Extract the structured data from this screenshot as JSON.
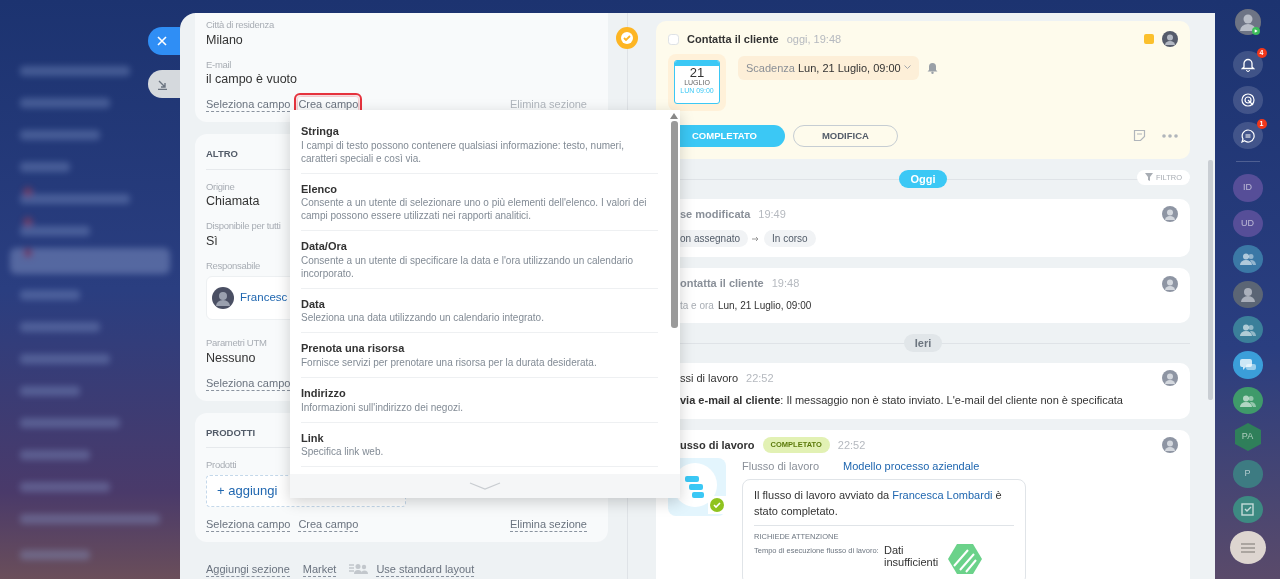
{
  "sections": [
    {
      "fields": [
        {
          "kind": "text",
          "label": "Città di residenza",
          "value": "Milano"
        },
        {
          "kind": "text",
          "label": "E-mail",
          "value": "il campo è vuoto"
        }
      ],
      "actions": [
        {
          "label": "Seleziona campo",
          "highlighted": false,
          "kind": "field"
        },
        {
          "label": "Crea campo",
          "highlighted": true,
          "kind": "field"
        },
        {
          "label": "Elimina sezione",
          "highlighted": false,
          "kind": "delete"
        }
      ]
    },
    {
      "title": "ALTRO",
      "fields": [
        {
          "kind": "text",
          "label": "Origine",
          "value": "Chiamata"
        },
        {
          "kind": "text",
          "label": "Disponibile per tutti",
          "value": "Sì"
        },
        {
          "kind": "person",
          "label": "Responsabile",
          "value": "Francesc"
        },
        {
          "kind": "text",
          "label": "Parametri UTM",
          "value": "Nessuno"
        }
      ],
      "actions": [
        {
          "label": "Seleziona campo",
          "highlighted": false,
          "kind": "field"
        }
      ]
    },
    {
      "title": "PRODOTTI",
      "fields": [
        {
          "kind": "add",
          "label": "Prodotti",
          "value": "+ aggiungi"
        }
      ],
      "actions": [
        {
          "label": "Seleziona campo",
          "highlighted": false,
          "kind": "field"
        },
        {
          "label": "Crea campo",
          "highlighted": false,
          "kind": "field"
        },
        {
          "label": "Elimina sezione",
          "highlighted": false,
          "kind": "delete"
        }
      ]
    }
  ],
  "footer_links": [
    {
      "label": "Aggiungi sezione"
    },
    {
      "label": "Market"
    }
  ],
  "layout_switch": {
    "label": "Use standard layout"
  },
  "field_type_menu": {
    "items": [
      {
        "title": "Stringa",
        "description": "I campi di testo possono contenere qualsiasi informazione: testo, numeri, caratteri speciali e così via."
      },
      {
        "title": "Elenco",
        "description": "Consente a un utente di selezionare uno o più elementi dell'elenco. I valori dei campi possono essere utilizzati nei rapporti analitici."
      },
      {
        "title": "Data/Ora",
        "description": "Consente a un utente di specificare la data e l'ora utilizzando un calendario incorporato."
      },
      {
        "title": "Data",
        "description": "Seleziona una data utilizzando un calendario integrato."
      },
      {
        "title": "Prenota una risorsa",
        "description": "Fornisce servizi per prenotare una risorsa per la durata desiderata."
      },
      {
        "title": "Indirizzo",
        "description": "Informazioni sull'indirizzo dei negozi."
      },
      {
        "title": "Link",
        "description": "Specifica link web."
      }
    ]
  },
  "task": {
    "checked": false,
    "title": "Contatta il cliente",
    "time": "oggi, 19:48",
    "calendar": {
      "day": "21",
      "month": "LUGLIO",
      "line": "LUN 09:00"
    },
    "deadline_label": "Scadenza",
    "deadline_value": "Lun, 21 Luglio, 09:00",
    "buttons": [
      {
        "label": "COMPLETATO",
        "kind": "primary"
      },
      {
        "label": "MODIFICA",
        "kind": "outline"
      }
    ]
  },
  "filter": {
    "label": "FILTRO"
  },
  "timeline": [
    {
      "kind": "separator",
      "label": "Oggi",
      "active": true
    },
    {
      "kind": "stage",
      "title": "se modificata",
      "time": "19:49",
      "stages": [
        "on assegnato",
        "In corso"
      ]
    },
    {
      "kind": "activity",
      "title": "ontatta il cliente",
      "time": "19:48",
      "detail_label": "ta e ora",
      "detail_value": "Lun, 21 Luglio, 09:00"
    },
    {
      "kind": "separator",
      "label": "Ieri",
      "active": false
    },
    {
      "kind": "message",
      "title": "ssi di lavoro",
      "time": "22:52",
      "text": "**via e-mail al cliente**: Il messaggio non è stato inviato. L'e-mail del cliente non è specificata"
    },
    {
      "kind": "workflow",
      "title": "usso di lavoro",
      "badge": "COMPLETATO",
      "time": "22:52",
      "link_label": "Flusso di lavoro",
      "link": "Modello processo aziendale",
      "sentence_before": "Il flusso di lavoro avviato da ",
      "sentence_link": "Francesca Lombardi",
      "sentence_after": " è stato completato.",
      "attention_title": "RICHIEDE ATTENZIONE",
      "attention_label": "Tempo di esecuzione flusso di lavoro:",
      "attention_value": "Dati insufficienti"
    }
  ],
  "rail": [
    {
      "kind": "user"
    },
    {
      "kind": "bell",
      "badge": "4"
    },
    {
      "kind": "target"
    },
    {
      "kind": "chat",
      "badge": "1"
    },
    {
      "kind": "divider"
    },
    {
      "kind": "initials",
      "text": "ID",
      "color": "#564e98"
    },
    {
      "kind": "initials",
      "text": "UD",
      "color": "#564e98"
    },
    {
      "kind": "group",
      "color": "#3b78a6"
    },
    {
      "kind": "avatar",
      "color": "#5b6575"
    },
    {
      "kind": "group",
      "color": "#3b7f9a"
    },
    {
      "kind": "messages",
      "color": "#3b9ed9"
    },
    {
      "kind": "group",
      "color": "#3f9a6a"
    },
    {
      "kind": "hexagon",
      "text": "PA",
      "color": "#2f7f5a"
    },
    {
      "kind": "initials",
      "text": "P",
      "color": "#3d7b82"
    },
    {
      "kind": "task",
      "color": "#3d8a82"
    }
  ]
}
